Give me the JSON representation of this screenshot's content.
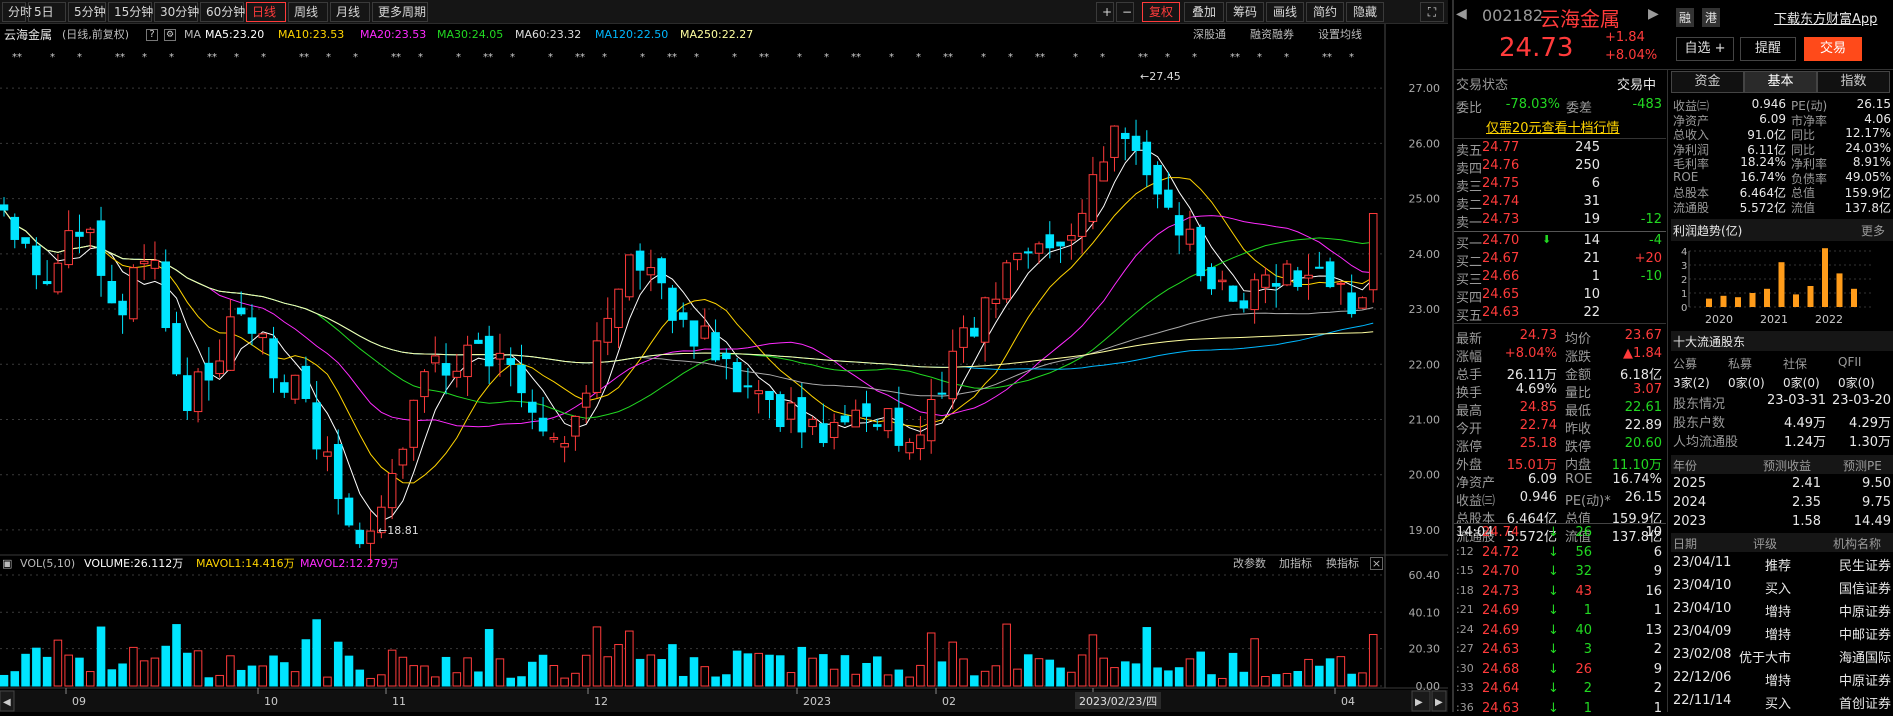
{
  "toolbar": {
    "periods": [
      "分时",
      "5日",
      "5分钟",
      "15分钟",
      "30分钟",
      "60分钟",
      "日线",
      "周线",
      "月线",
      "更多周期"
    ],
    "active": "日线",
    "right": [
      "+",
      "−",
      "复权",
      "叠加",
      "筹码",
      "画线",
      "简约",
      "隐藏"
    ]
  },
  "info": {
    "name": "云海金属",
    "mode": "(日线,前复权)",
    "ma_label": "MA",
    "ma5": "MA5:23.20",
    "ma10": "MA10:23.53",
    "ma20": "MA20:23.53",
    "ma30": "MA30:24.05",
    "ma60": "MA60:23.32",
    "ma120": "MA120:22.50",
    "ma250": "MA250:22.27",
    "links": [
      "深股通",
      "融资融券",
      "设置均线"
    ]
  },
  "chart_data": {
    "type": "candlestick",
    "ylim": [
      18.6,
      27.8
    ],
    "yticks": [
      "27.00",
      "26.00",
      "25.00",
      "24.00",
      "23.00",
      "22.00",
      "21.00",
      "20.00",
      "19.00"
    ],
    "vol_ticks": [
      "60.40",
      "40.10",
      "20.30",
      "0.00"
    ],
    "xticks": [
      "09",
      "10",
      "11",
      "12",
      "2023",
      "02",
      "03",
      "04"
    ],
    "high_label": "27.45",
    "low_label": "18.81",
    "cursor_date": "2023/02/23/四",
    "colors": {
      "up": "#ff3b3b",
      "down": "#00e5ff",
      "ma5": "#ffffff",
      "ma10": "#ffd400",
      "ma20": "#ff2bff",
      "ma30": "#22d822",
      "ma60": "#aaaaaa",
      "ma120": "#00b8ff",
      "ma250": "#ffffa0"
    }
  },
  "vol": {
    "title": "VOL(5,10)",
    "volume": "VOLUME:26.112万",
    "mavol1": "MAVOL1:14.416万",
    "mavol2": "MAVOL2:12.279万",
    "links": [
      "改参数",
      "加指标",
      "换指标"
    ]
  },
  "quote": {
    "code": "002182",
    "name": "云海金属",
    "tags": [
      "融",
      "港"
    ],
    "download": "下载东方财富App",
    "price": "24.73",
    "change": "+1.84",
    "pct": "+8.04%",
    "buttons": [
      "自选 +",
      "提醒",
      "交易"
    ],
    "state_label": "交易状态",
    "state_value": "交易中",
    "weibi_label": "委比",
    "weibi": "-78.03%",
    "weicha_label": "委差",
    "weicha": "-483",
    "promo": "仅需20元查看十档行情",
    "sells": [
      {
        "l": "卖五",
        "p": "24.77",
        "v": "245",
        "c": ""
      },
      {
        "l": "卖四",
        "p": "24.76",
        "v": "250",
        "c": ""
      },
      {
        "l": "卖三",
        "p": "24.75",
        "v": "6",
        "c": ""
      },
      {
        "l": "卖二",
        "p": "24.74",
        "v": "31",
        "c": ""
      },
      {
        "l": "卖一",
        "p": "24.73",
        "v": "19",
        "c": "-12"
      }
    ],
    "buys": [
      {
        "l": "买一",
        "p": "24.70",
        "v": "14",
        "c": "-4"
      },
      {
        "l": "买二",
        "p": "24.67",
        "v": "21",
        "c": "+20"
      },
      {
        "l": "买三",
        "p": "24.66",
        "v": "1",
        "c": "-10"
      },
      {
        "l": "买四",
        "p": "24.65",
        "v": "10",
        "c": ""
      },
      {
        "l": "买五",
        "p": "24.63",
        "v": "22",
        "c": ""
      }
    ],
    "stats": [
      [
        "最新",
        "24.73",
        "均价",
        "23.67"
      ],
      [
        "涨幅",
        "+8.04%",
        "涨跌",
        "▲1.84"
      ],
      [
        "总手",
        "26.11万",
        "金额",
        "6.18亿"
      ],
      [
        "换手",
        "4.69%",
        "量比",
        "3.07"
      ],
      [
        "最高",
        "24.85",
        "最低",
        "22.61"
      ],
      [
        "今开",
        "22.74",
        "昨收",
        "22.89"
      ],
      [
        "涨停",
        "25.18",
        "跌停",
        "20.60"
      ],
      [
        "外盘",
        "15.01万",
        "内盘",
        "11.10万"
      ],
      [
        "净资产",
        "6.09",
        "ROE",
        "16.74%"
      ],
      [
        "收益㈢",
        "0.946",
        "PE(动)*",
        "26.15"
      ],
      [
        "总股本",
        "6.464亿",
        "总值",
        "159.9亿"
      ],
      [
        "流通股",
        "5.572亿",
        "流值",
        "137.8亿"
      ]
    ],
    "ticks": [
      [
        "14:04",
        "24.74",
        "26",
        "10"
      ],
      [
        ":12",
        "24.72",
        "56",
        "6"
      ],
      [
        ":15",
        "24.70",
        "32",
        "9"
      ],
      [
        ":18",
        "24.73",
        "43",
        "16"
      ],
      [
        ":21",
        "24.69",
        "1",
        "1"
      ],
      [
        ":24",
        "24.69",
        "40",
        "13"
      ],
      [
        ":27",
        "24.63",
        "3",
        "2"
      ],
      [
        ":30",
        "24.68",
        "26",
        "9"
      ],
      [
        ":33",
        "24.64",
        "2",
        "2"
      ],
      [
        ":36",
        "24.63",
        "1",
        "1"
      ]
    ]
  },
  "fund": {
    "tabs": [
      "资金",
      "基本",
      "指数"
    ],
    "active": "基本",
    "rows": [
      [
        "收益㈢",
        "0.946",
        "PE(动)",
        "26.15"
      ],
      [
        "净资产",
        "6.09",
        "市净率",
        "4.06"
      ],
      [
        "总收入",
        "91.0亿",
        "同比",
        "12.17%"
      ],
      [
        "净利润",
        "6.11亿",
        "同比",
        "24.03%"
      ],
      [
        "毛利率",
        "18.24%",
        "净利率",
        "8.91%"
      ],
      [
        "ROE",
        "16.74%",
        "负债率",
        "49.05%"
      ],
      [
        "总股本",
        "6.464亿",
        "总值",
        "159.9亿"
      ],
      [
        "流通股",
        "5.572亿",
        "流值",
        "137.8亿"
      ]
    ],
    "trend_title": "利润趋势(亿)",
    "more": "更多",
    "trend_years": [
      "2020",
      "2021",
      "2022"
    ],
    "trend_ticks": [
      "4",
      "3",
      "2",
      "1",
      "0"
    ],
    "trend_values": [
      0.6,
      0.8,
      0.7,
      1.0,
      1.3,
      3.2,
      0.9,
      1.5,
      4.2,
      2.4,
      1.3
    ],
    "holders_title": "十大流通股东",
    "holders_head": [
      "公募",
      "私募",
      "社保",
      "QFII"
    ],
    "holders_vals": [
      "3家(2)",
      "0家(0)",
      "0家(0)",
      "0家(0)"
    ],
    "holders_rows": [
      [
        "股东情况",
        "23-03-31",
        "23-03-20"
      ],
      [
        "股东户数",
        "4.49万",
        "4.29万"
      ],
      [
        "人均流通股",
        "1.24万",
        "1.30万"
      ]
    ],
    "forecast_head": [
      "年份",
      "预测收益",
      "预测PE"
    ],
    "forecast": [
      [
        "2025",
        "2.41",
        "9.50"
      ],
      [
        "2024",
        "2.35",
        "9.75"
      ],
      [
        "2023",
        "1.58",
        "14.49"
      ]
    ],
    "rating_head": [
      "日期",
      "评级",
      "机构名称"
    ],
    "ratings": [
      [
        "23/04/11",
        "推荐",
        "民生证券"
      ],
      [
        "23/04/10",
        "买入",
        "国信证券"
      ],
      [
        "23/04/10",
        "增持",
        "中原证券"
      ],
      [
        "23/04/09",
        "增持",
        "中邮证券"
      ],
      [
        "23/02/08",
        "优于大市",
        "海通国际"
      ],
      [
        "22/12/06",
        "增持",
        "中原证券"
      ],
      [
        "22/11/14",
        "买入",
        "首创证券"
      ]
    ]
  }
}
